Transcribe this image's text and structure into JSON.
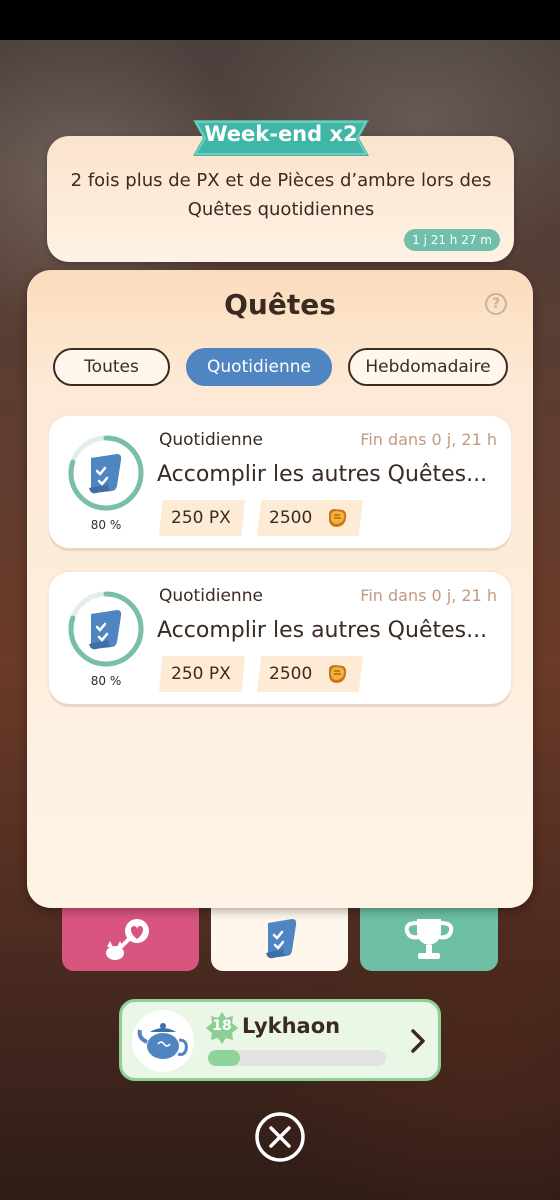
{
  "event": {
    "ribbon_label": "Week-end x2",
    "description": "2 fois plus de PX et de Pièces d’ambre lors des Quêtes quotidiennes",
    "timer": "1 j 21 h 27 m",
    "ribbon_color": "#3fb6a6"
  },
  "panel": {
    "title": "Quêtes",
    "help_icon": "?",
    "tabs": [
      {
        "label": "Toutes",
        "active": false
      },
      {
        "label": "Quotidienne",
        "active": true
      },
      {
        "label": "Hebdomadaire",
        "active": false
      }
    ]
  },
  "quests": [
    {
      "category": "Quotidienne",
      "ends": "Fin dans 0 j, 21 h",
      "title": "Accomplir les autres Quêtes...",
      "progress_label": "80 %",
      "progress_fraction": 0.8,
      "reward_xp": "250 PX",
      "reward_coins": "2500",
      "icon": "quest-scroll-icon"
    },
    {
      "category": "Quotidienne",
      "ends": "Fin dans 0 j, 21 h",
      "title": "Accomplir les autres Quêtes...",
      "progress_label": "80 %",
      "progress_fraction": 0.8,
      "reward_xp": "250 PX",
      "reward_coins": "2500",
      "icon": "quest-scroll-icon"
    }
  ],
  "bottom_tabs": [
    {
      "icon": "heart-flower-icon",
      "color": "#d8557f"
    },
    {
      "icon": "quest-scroll-icon",
      "color": "#fff7ec",
      "active": true
    },
    {
      "icon": "trophy-icon",
      "color": "#6dbfa4"
    }
  ],
  "player": {
    "level": "18",
    "name": "Lykhaon",
    "xp_fraction": 0.18,
    "avatar_icon": "teapot-icon"
  },
  "close_icon": "close-icon"
}
